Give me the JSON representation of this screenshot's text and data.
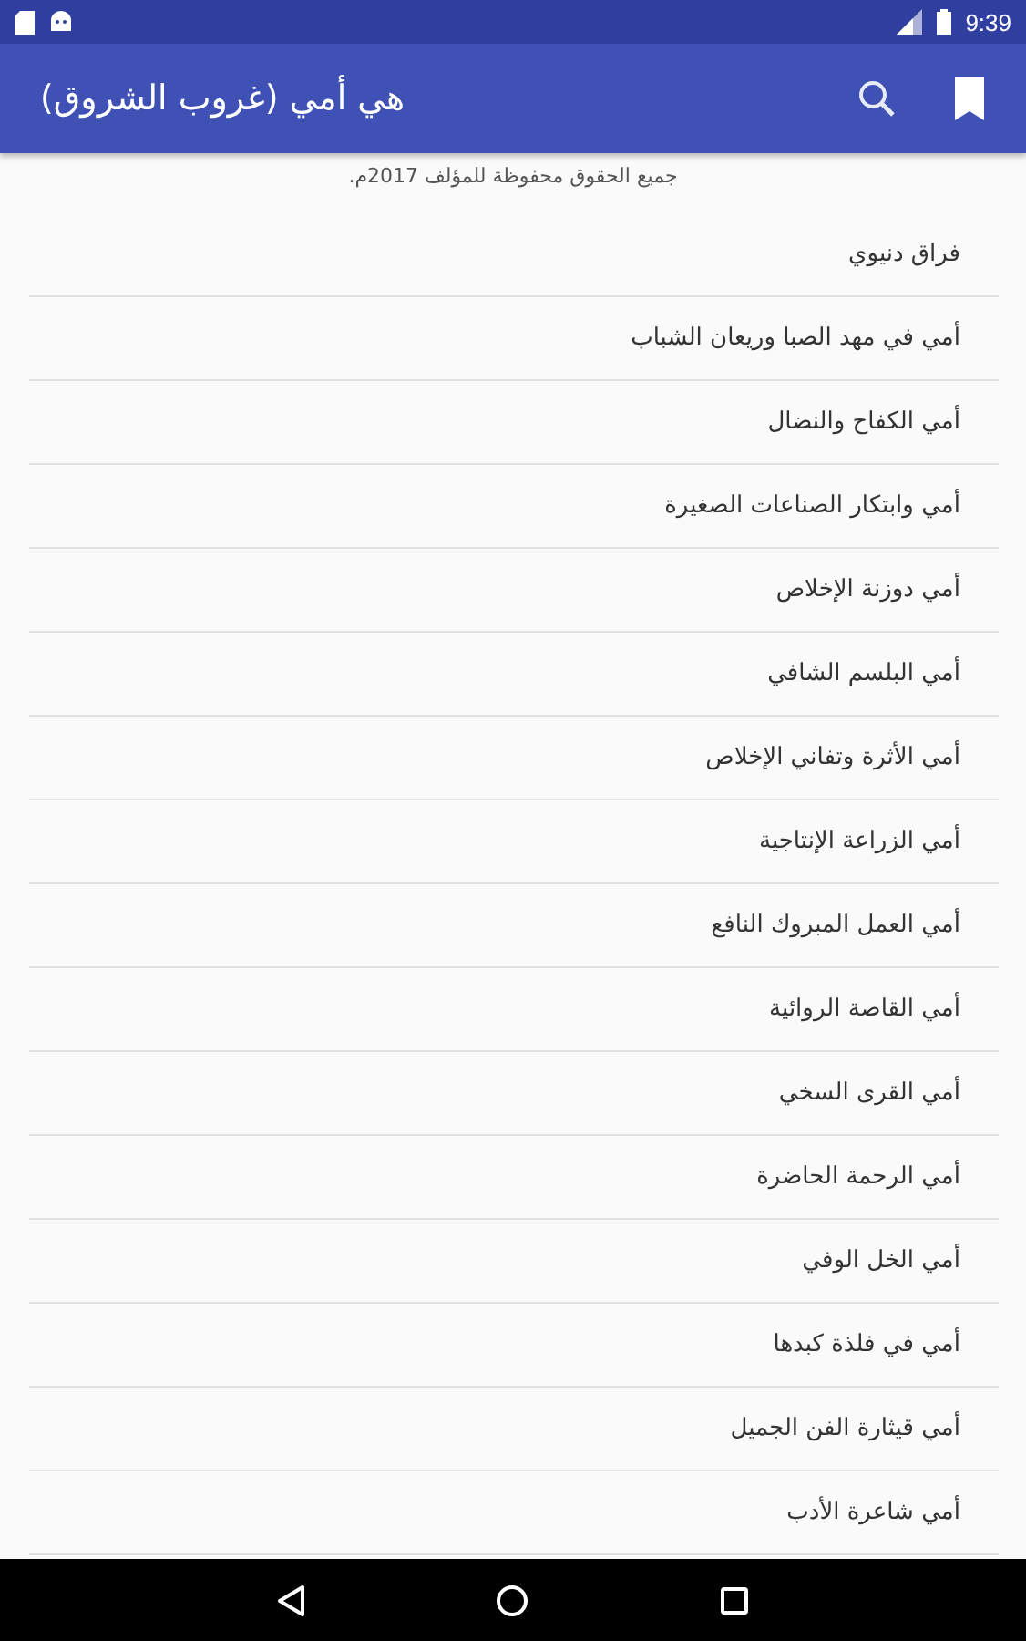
{
  "status_bar": {
    "time": "9:39"
  },
  "app_bar": {
    "title": "هي أمي (غروب الشروق)"
  },
  "copyright": "جميع الحقوق محفوظة للمؤلف 2017م.",
  "items": [
    "فراق دنيوي",
    "أمي في مهد الصبا وريعان الشباب",
    "أمي الكفاح والنضال",
    "أمي وابتكار الصناعات الصغيرة",
    "أمي دوزنة الإخلاص",
    "أمي البلسم الشافي",
    "أمي الأثرة وتفاني الإخلاص",
    "أمي الزراعة الإنتاجية",
    "أمي العمل المبروك النافع",
    "أمي القاصة الروائية",
    "أمي القرى السخي",
    "أمي الرحمة الحاضرة",
    "أمي الخل الوفي",
    "أمي في فلذة كبدها",
    "أمي قيثارة الفن الجميل",
    "أمي شاعرة الأدب"
  ]
}
